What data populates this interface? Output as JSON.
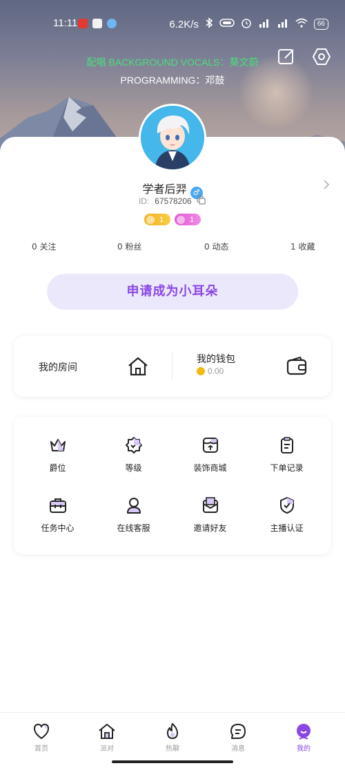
{
  "status_bar": {
    "time": "11:11",
    "network_speed": "6.2K/s",
    "battery": "66",
    "signal1": "HD",
    "signal2": "HD"
  },
  "header": {
    "lyric_line_1": "配唱 BACKGROUND VOCALS：葵文蔚",
    "lyric_line_2": "PROGRAMMING：邓鼓",
    "edit_icon": "edit-icon",
    "settings_icon": "settings-hex-icon"
  },
  "profile": {
    "username": "学者后羿",
    "gender_icon": "male-icon",
    "id_label": "ID:",
    "id_value": "67578206",
    "badges": [
      {
        "value": "1",
        "color": "#f5b323"
      },
      {
        "value": "1",
        "color": "#e05ad2"
      }
    ],
    "stats": [
      {
        "label": "0 关注"
      },
      {
        "label": "0 粉丝"
      },
      {
        "label": "0 动态"
      },
      {
        "label": "1 收藏"
      }
    ]
  },
  "apply_button": "申请成为小耳朵",
  "quick_links": {
    "room": {
      "label": "我的房间",
      "icon": "house-icon"
    },
    "wallet": {
      "label": "我的钱包",
      "balance": "0.00",
      "icon": "wallet-icon"
    }
  },
  "features": [
    {
      "label": "爵位",
      "icon": "crown-icon"
    },
    {
      "label": "等级",
      "icon": "level-badge-icon"
    },
    {
      "label": "装饰商城",
      "icon": "shop-icon"
    },
    {
      "label": "下单记录",
      "icon": "clipboard-icon"
    },
    {
      "label": "任务中心",
      "icon": "toolbox-icon"
    },
    {
      "label": "在线客服",
      "icon": "person-icon"
    },
    {
      "label": "邀请好友",
      "icon": "mail-icon"
    },
    {
      "label": "主播认证",
      "icon": "shield-check-icon"
    }
  ],
  "tabs": [
    {
      "label": "首页",
      "icon": "heart-icon",
      "active": false
    },
    {
      "label": "派对",
      "icon": "house-icon",
      "active": false
    },
    {
      "label": "热聊",
      "icon": "flame-icon",
      "active": false
    },
    {
      "label": "消息",
      "icon": "message-icon",
      "active": false
    },
    {
      "label": "我的",
      "icon": "avatar-icon",
      "active": true
    }
  ],
  "colors": {
    "accent": "#8a47e6",
    "lyric_green": "#49e07a",
    "apply_bg": "#ece8fb"
  }
}
